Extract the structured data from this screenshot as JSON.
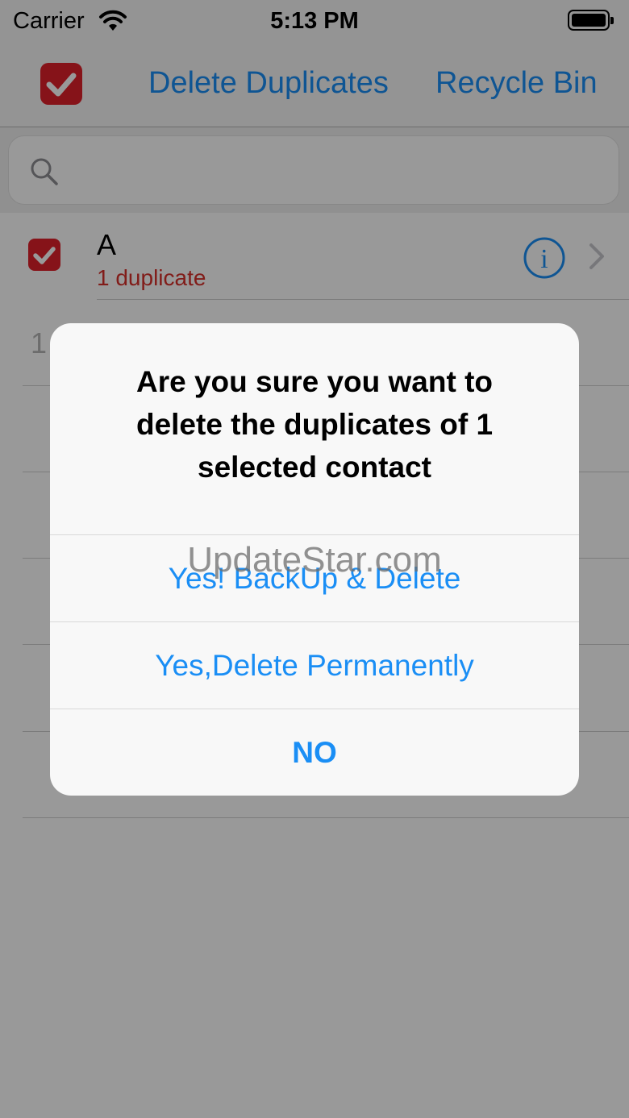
{
  "status_bar": {
    "carrier": "Carrier",
    "time": "5:13 PM"
  },
  "nav": {
    "select_all_checked": true,
    "delete_duplicates_label": "Delete Duplicates",
    "recycle_bin_label": "Recycle Bin"
  },
  "search": {
    "placeholder": ""
  },
  "list": {
    "rows": [
      {
        "title": "A",
        "subtitle": "1 duplicate",
        "checked": true
      }
    ],
    "second_section_index": "1"
  },
  "alert": {
    "message": "Are you sure you want to delete the duplicates of 1 selected contact",
    "buttons": {
      "backup_delete": "Yes! BackUp & Delete",
      "delete_permanently": "Yes,Delete Permanently",
      "no": "NO"
    }
  },
  "watermark": "UpdateStar.com",
  "colors": {
    "accent": "#1a8ef5",
    "check_red": "#e0202a",
    "subtitle_red": "#d8302a"
  }
}
